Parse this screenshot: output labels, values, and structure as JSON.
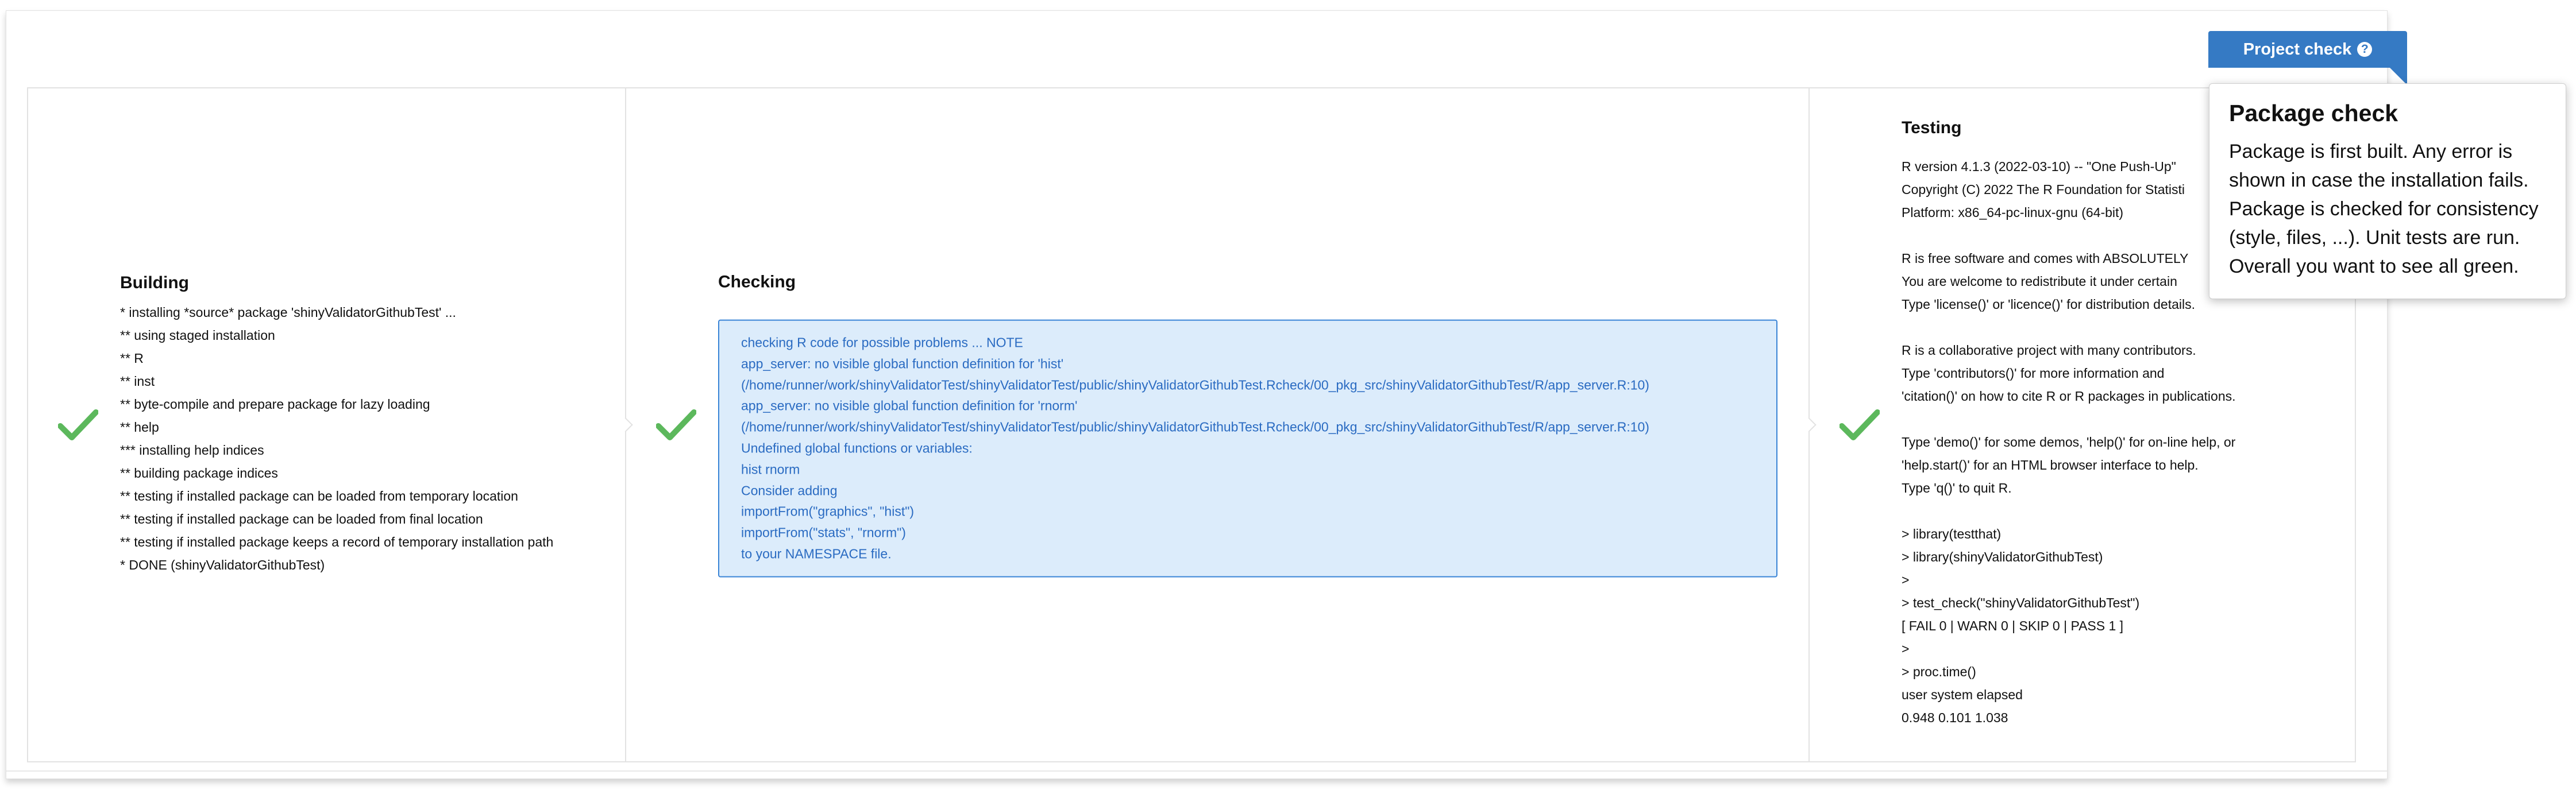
{
  "project_check": {
    "label": "Project check",
    "help_icon": "?"
  },
  "popover": {
    "title": "Package check",
    "body": "Package is first built. Any error is shown in case the installation fails. Package is checked for consistency (style, files, ...). Unit tests are run. Overall you want to see all green."
  },
  "colors": {
    "success": "#5cb85c",
    "accent": "#357ac4",
    "note_bg": "#dcecfb",
    "note_text": "#2a6bc2"
  },
  "steps": {
    "building": {
      "title": "Building",
      "status_icon": "checkmark-icon",
      "log": "* installing *source* package 'shinyValidatorGithubTest' ...\n** using staged installation\n** R\n** inst\n** byte-compile and prepare package for lazy loading\n** help\n*** installing help indices\n** building package indices\n** testing if installed package can be loaded from temporary location\n** testing if installed package can be loaded from final location\n** testing if installed package keeps a record of temporary installation path\n* DONE (shinyValidatorGithubTest)"
    },
    "checking": {
      "title": "Checking",
      "status_icon": "checkmark-icon",
      "note": "checking R code for possible problems ... NOTE\napp_server: no visible global function definition for 'hist'\n(/home/runner/work/shinyValidatorTest/shinyValidatorTest/public/shinyValidatorGithubTest.Rcheck/00_pkg_src/shinyValidatorGithubTest/R/app_server.R:10)\napp_server: no visible global function definition for 'rnorm'\n(/home/runner/work/shinyValidatorTest/shinyValidatorTest/public/shinyValidatorGithubTest.Rcheck/00_pkg_src/shinyValidatorGithubTest/R/app_server.R:10)\nUndefined global functions or variables:\nhist rnorm\nConsider adding\nimportFrom(\"graphics\", \"hist\")\nimportFrom(\"stats\", \"rnorm\")\nto your NAMESPACE file."
    },
    "testing": {
      "title": "Testing",
      "status_icon": "checkmark-icon",
      "log": "R version 4.1.3 (2022-03-10) -- \"One Push-Up\"\nCopyright (C) 2022 The R Foundation for Statisti\nPlatform: x86_64-pc-linux-gnu (64-bit)\n\nR is free software and comes with ABSOLUTELY\nYou are welcome to redistribute it under certain\nType 'license()' or 'licence()' for distribution details.\n\nR is a collaborative project with many contributors.\nType 'contributors()' for more information and\n'citation()' on how to cite R or R packages in publications.\n\nType 'demo()' for some demos, 'help()' for on-line help, or\n'help.start()' for an HTML browser interface to help.\nType 'q()' to quit R.\n\n> library(testthat)\n> library(shinyValidatorGithubTest)\n>\n> test_check(\"shinyValidatorGithubTest\")\n[ FAIL 0 | WARN 0 | SKIP 0 | PASS 1 ]\n>\n> proc.time()\nuser system elapsed\n0.948 0.101 1.038"
    }
  }
}
